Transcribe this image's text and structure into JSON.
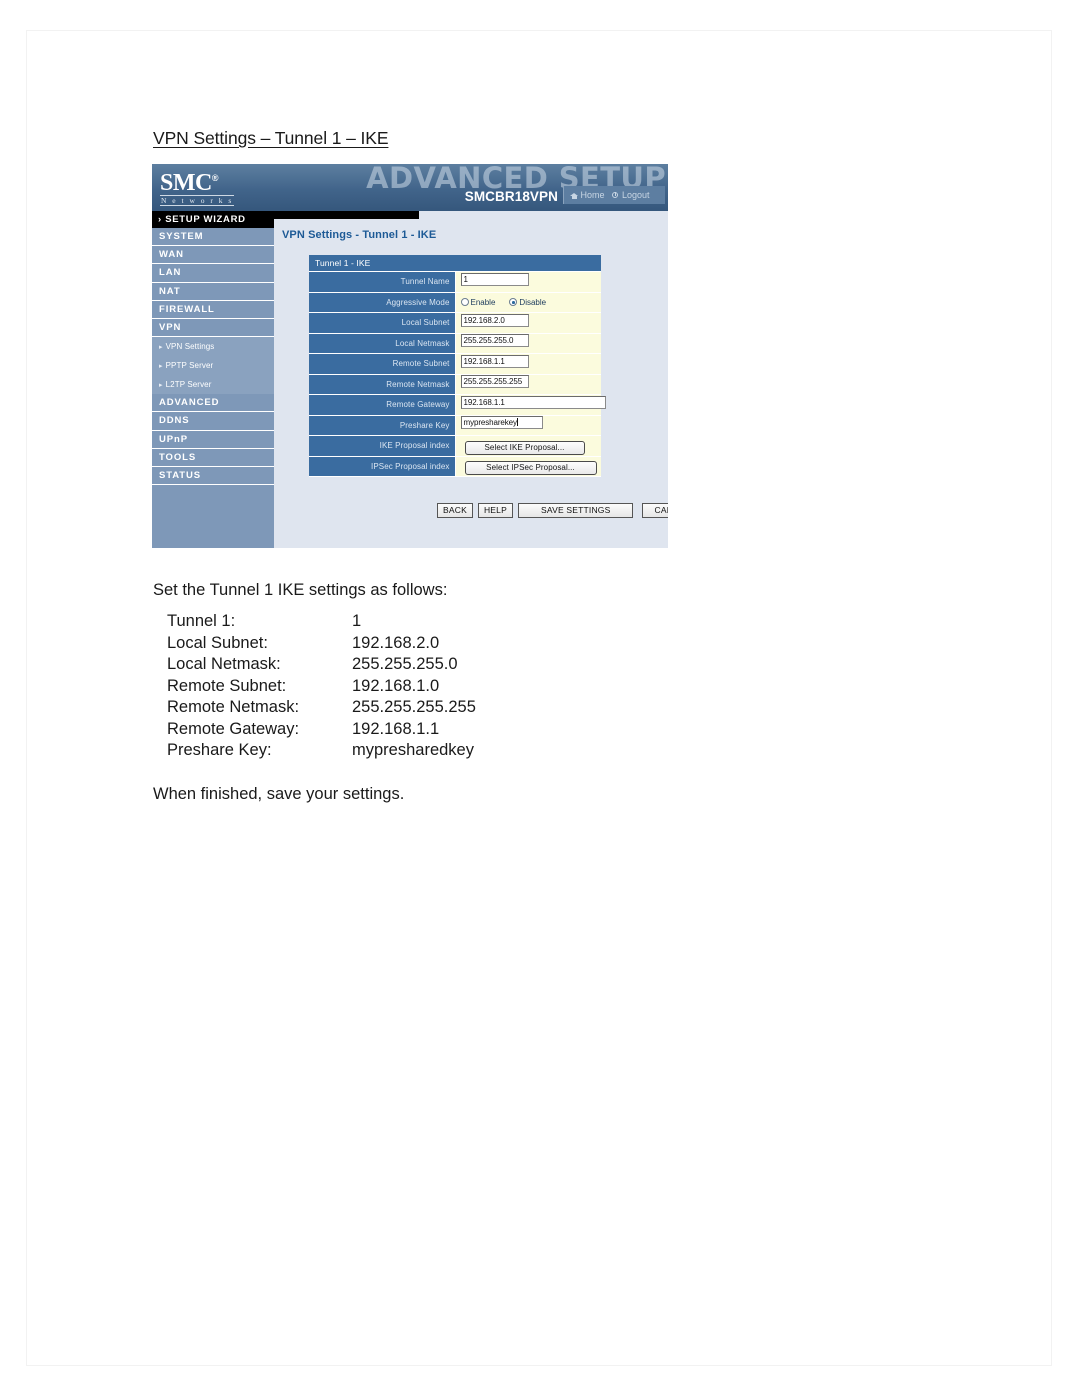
{
  "document": {
    "heading": "VPN Settings – Tunnel 1 – IKE",
    "intro": "Set the Tunnel 1 IKE settings as follows:",
    "closing": "When finished, save your settings.",
    "settings": [
      {
        "label": "Tunnel 1:",
        "value": "1"
      },
      {
        "label": "Local Subnet:",
        "value": "192.168.2.0"
      },
      {
        "label": "Local Netmask:",
        "value": "255.255.255.0"
      },
      {
        "label": "Remote Subnet:",
        "value": "192.168.1.0"
      },
      {
        "label": "Remote Netmask:",
        "value": "255.255.255.255"
      },
      {
        "label": "Remote Gateway:",
        "value": "192.168.1.1"
      },
      {
        "label": "Preshare Key:",
        "value": "mypresharedkey"
      }
    ]
  },
  "router_ui": {
    "header": {
      "watermark": "ADVANCED SETUP",
      "logo_main": "SMC",
      "logo_registered": "®",
      "logo_sub": "N e t w o r k s",
      "model": "SMCBR18VPN",
      "home_label": "Home",
      "logout_label": "Logout"
    },
    "sidebar": {
      "wizard_label": "› SETUP WIZARD",
      "items": [
        {
          "label": "SYSTEM",
          "type": "main"
        },
        {
          "label": "WAN",
          "type": "main"
        },
        {
          "label": "LAN",
          "type": "main"
        },
        {
          "label": "NAT",
          "type": "main"
        },
        {
          "label": "FIREWALL",
          "type": "main"
        },
        {
          "label": "VPN",
          "type": "main"
        },
        {
          "label": "VPN Settings",
          "type": "sub"
        },
        {
          "label": "PPTP Server",
          "type": "sub"
        },
        {
          "label": "L2TP Server",
          "type": "sub"
        },
        {
          "label": "ADVANCED",
          "type": "main"
        },
        {
          "label": "DDNS",
          "type": "main"
        },
        {
          "label": "UPnP",
          "type": "main"
        },
        {
          "label": "TOOLS",
          "type": "main"
        },
        {
          "label": "STATUS",
          "type": "main"
        }
      ]
    },
    "content": {
      "page_title": "VPN Settings - Tunnel 1 - IKE",
      "table_header": "Tunnel 1 - IKE",
      "fields": {
        "tunnel_name_label": "Tunnel Name",
        "tunnel_name_value": "1",
        "aggressive_mode_label": "Aggressive Mode",
        "aggressive_enable_label": "Enable",
        "aggressive_disable_label": "Disable",
        "aggressive_selected": "Disable",
        "local_subnet_label": "Local Subnet",
        "local_subnet_value": "192.168.2.0",
        "local_netmask_label": "Local Netmask",
        "local_netmask_value": "255.255.255.0",
        "remote_subnet_label": "Remote Subnet",
        "remote_subnet_value": "192.168.1.1",
        "remote_netmask_label": "Remote Netmask",
        "remote_netmask_value": "255.255.255.255",
        "remote_gateway_label": "Remote Gateway",
        "remote_gateway_value": "192.168.1.1",
        "preshare_key_label": "Preshare Key",
        "preshare_key_value": "mypresharekey",
        "ike_proposal_label": "IKE Proposal index",
        "ike_proposal_button": "Select IKE Proposal...",
        "ipsec_proposal_label": "IPSec Proposal index",
        "ipsec_proposal_button": "Select IPSec Proposal..."
      },
      "actions": {
        "back": "BACK",
        "help": "HELP",
        "save": "SAVE SETTINGS",
        "cancel": "CANCEL"
      }
    }
  },
  "colors": {
    "header_blue": "#41648a",
    "sidebar_blue": "#7e98b8",
    "label_blue": "#3a6ca0",
    "field_yellow": "#fbfbdd",
    "content_bg": "#dfe5ef",
    "title_blue": "#1d5a96"
  }
}
